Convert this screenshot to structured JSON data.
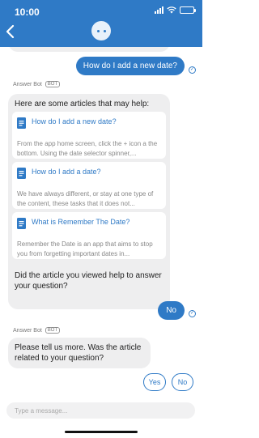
{
  "status_bar": {
    "time": "10:00"
  },
  "header": {
    "back_icon": "chevron-left-icon",
    "avatar_icon": "bot-face-icon",
    "background_color": "#2f7ac6"
  },
  "messages": {
    "user_question": "How do I add a new date?",
    "bot_name": "Answer Bot",
    "bot_badge": "BOT",
    "articles_intro": "Here are some articles that may help:",
    "articles": [
      {
        "title": "How do I add a new date?",
        "snippet": "From the app home screen, click the + icon a the bottom. Using the date selector spinner,..."
      },
      {
        "title": "How do I add a date?",
        "snippet": "We have always different, or stay at one type of the content, these tasks that it does not..."
      },
      {
        "title": "What is Remember The Date?",
        "snippet": "Remember the Date is an app that aims to stop you from forgetting important dates in..."
      }
    ],
    "feedback_question": "Did the article you viewed help to answer your question?",
    "user_reply": "No",
    "bot_name_2": "Answer Bot",
    "bot_badge_2": "BOT",
    "follow_up": "Please tell us more. Was the article related to your question?"
  },
  "choices": {
    "yes": "Yes",
    "no": "No"
  },
  "composer": {
    "placeholder": "Type a message..."
  },
  "colors": {
    "accent": "#2f7ac6",
    "bot_bubble": "#eeeeef"
  }
}
